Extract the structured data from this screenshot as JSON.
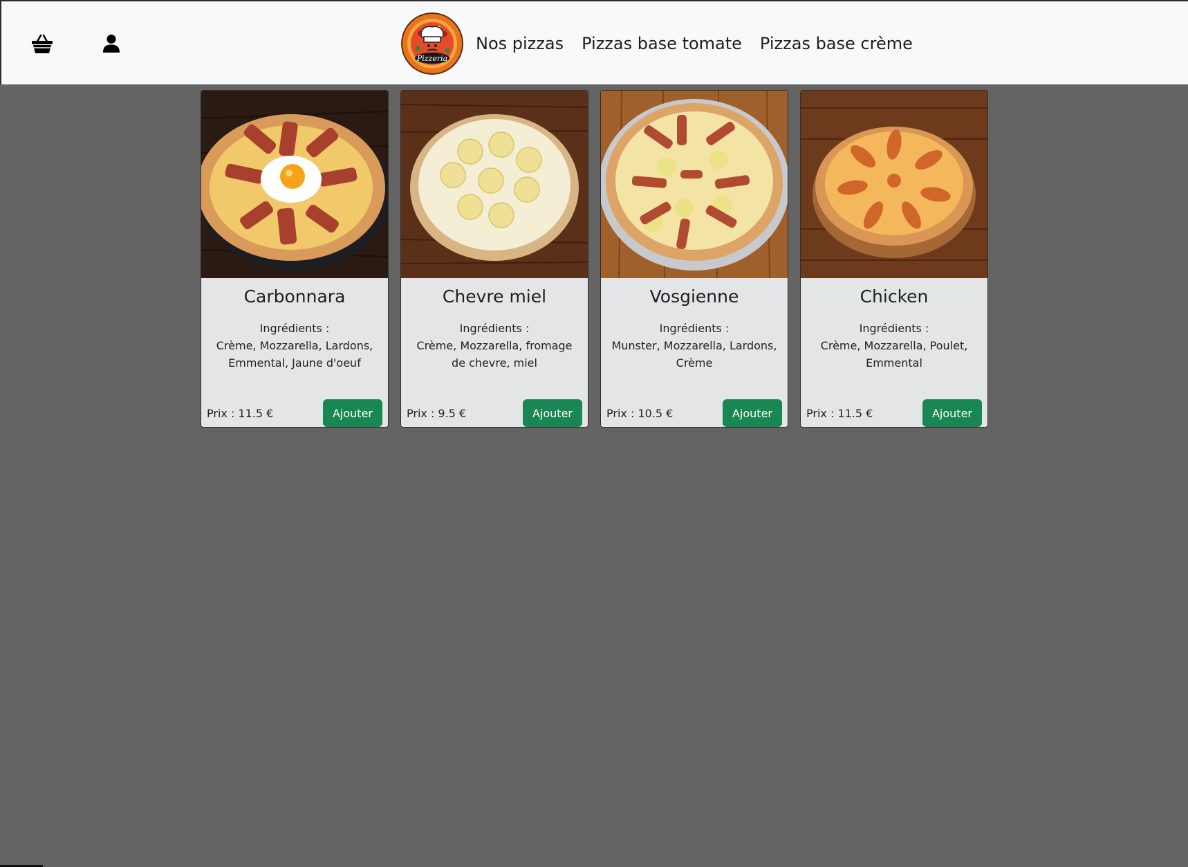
{
  "header": {
    "basket_icon": "basket-icon",
    "user_icon": "user-icon",
    "logo_text": "Pizzeria",
    "nav": [
      {
        "label": "Nos pizzas"
      },
      {
        "label": "Pizzas base tomate"
      },
      {
        "label": "Pizzas base crème"
      }
    ]
  },
  "colors": {
    "background": "#646464",
    "navbar": "#f8f9fa",
    "card": "#e4e5e7",
    "button": "#198754"
  },
  "pizzas": [
    {
      "name": "Carbonnara",
      "ingredients_label": "Ingrédients :",
      "ingredients": "Crème, Mozzarella, Lardons, Emmental, Jaune d'oeuf",
      "price": "Prix : 11.5 €",
      "button": "Ajouter"
    },
    {
      "name": "Chevre miel",
      "ingredients_label": "Ingrédients :",
      "ingredients": "Crème, Mozzarella, fromage de chevre, miel",
      "price": "Prix : 9.5 €",
      "button": "Ajouter"
    },
    {
      "name": "Vosgienne",
      "ingredients_label": "Ingrédients :",
      "ingredients": "Munster, Mozzarella, Lardons, Crème",
      "price": "Prix : 10.5 €",
      "button": "Ajouter"
    },
    {
      "name": "Chicken",
      "ingredients_label": "Ingrédients :",
      "ingredients": "Crème, Mozzarella, Poulet, Emmental",
      "price": "Prix : 11.5 €",
      "button": "Ajouter"
    }
  ]
}
